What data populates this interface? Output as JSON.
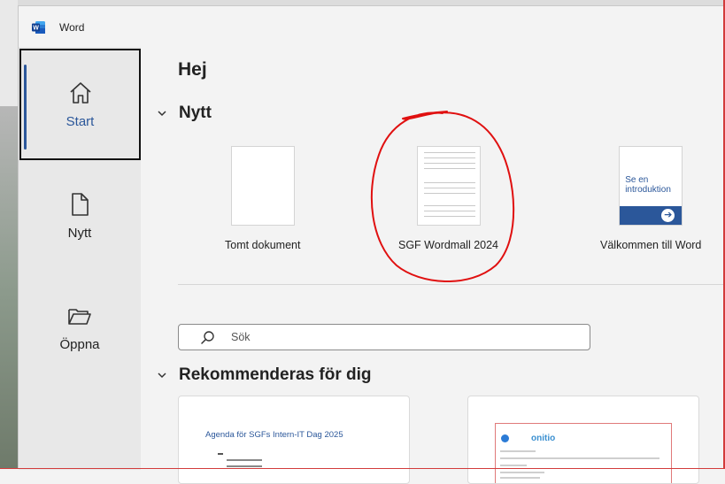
{
  "window": {
    "app_name": "Word"
  },
  "nav": {
    "items": [
      {
        "label": "Start",
        "icon": "home-icon",
        "active": true
      },
      {
        "label": "Nytt",
        "icon": "new-document-icon",
        "active": false
      },
      {
        "label": "Öppna",
        "icon": "folder-open-icon",
        "active": false
      }
    ]
  },
  "main": {
    "greeting": "Hej",
    "new_section": {
      "title": "Nytt",
      "templates": [
        {
          "label": "Tomt dokument",
          "thumb": "blank"
        },
        {
          "label": "SGF Wordmall 2024",
          "thumb": "lined"
        },
        {
          "label": "Välkommen till Word",
          "thumb": "intro",
          "thumb_text": "Se en introduktion"
        }
      ]
    },
    "search": {
      "placeholder": "Sök"
    },
    "recommended": {
      "title": "Rekommenderas för dig",
      "cards": [
        {
          "doc_title": "Agenda för SGFs Intern-IT Dag 2025"
        },
        {
          "brand": "onitio"
        }
      ]
    }
  },
  "colors": {
    "accent": "#2b579a",
    "annotation_red": "#e01010"
  }
}
